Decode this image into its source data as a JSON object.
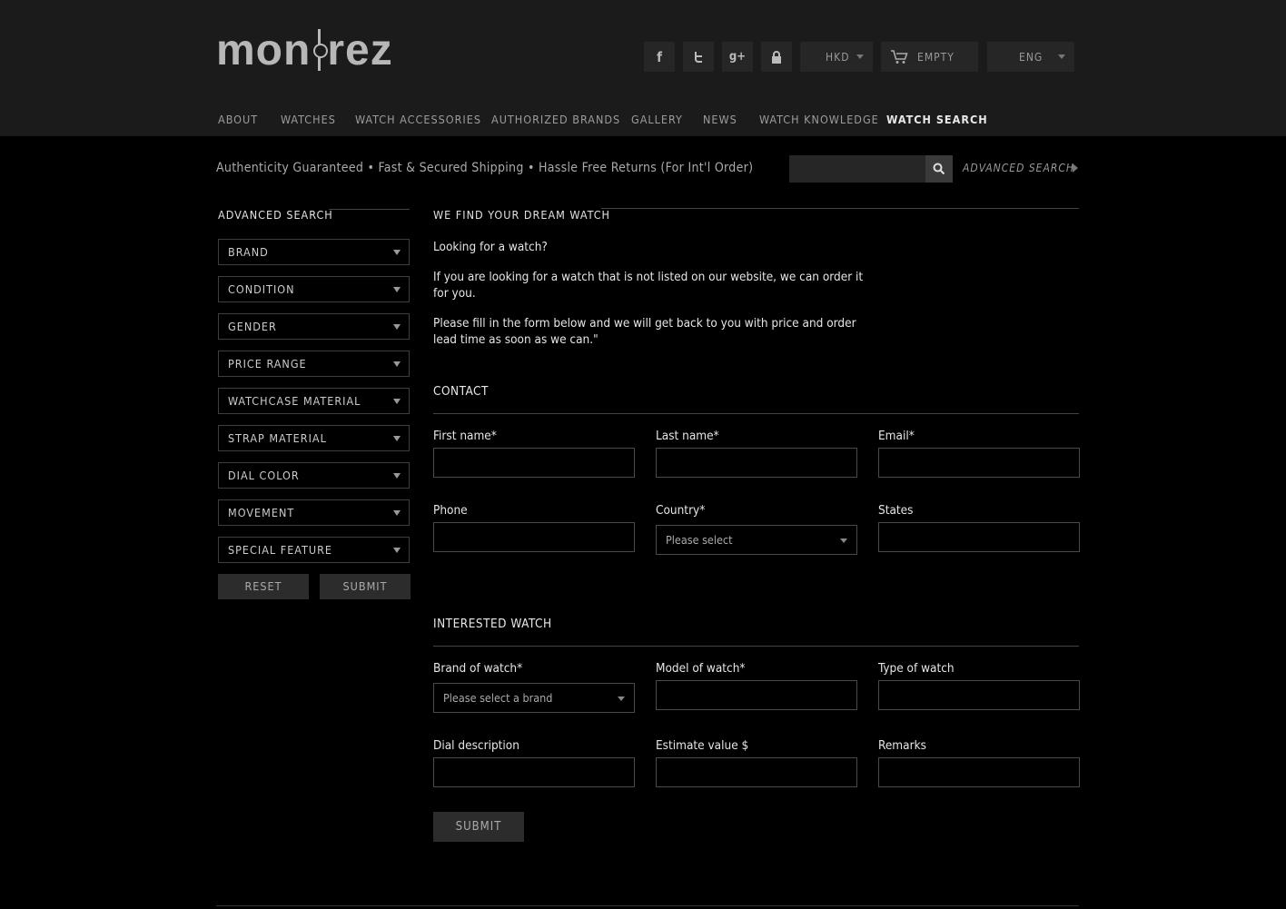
{
  "header": {
    "logo_text": {
      "a": "mon",
      "b": "rez"
    },
    "social": {
      "facebook": "f",
      "twitter": "t",
      "googleplus": "g+"
    },
    "currency": "HKD",
    "cart": "EMPTY",
    "language": "ENG"
  },
  "nav": {
    "items": [
      "ABOUT",
      "WATCHES",
      "WATCH ACCESSORIES",
      "AUTHORIZED BRANDS",
      "GALLERY",
      "NEWS",
      "WATCH KNOWLEDGE",
      "WATCH SEARCH"
    ],
    "active": "WATCH SEARCH"
  },
  "promo": {
    "text": "Authenticity Guaranteed • Fast & Secured Shipping • Hassle Free Returns (For Int'l Order)",
    "search_placeholder": "",
    "advanced_link": "ADVANCED SEARCH"
  },
  "sidebar": {
    "title": "ADVANCED SEARCH",
    "filters": [
      "BRAND",
      "CONDITION",
      "GENDER",
      "PRICE RANGE",
      "WATCHCASE MATERIAL",
      "STRAP MATERIAL",
      "DIAL COLOR",
      "MOVEMENT",
      "SPECIAL FEATURE"
    ],
    "reset_label": "RESET",
    "submit_label": "SUBMIT"
  },
  "main": {
    "title": "WE FIND YOUR DREAM WATCH",
    "para1": "Looking for a watch?",
    "para2": "If you are looking for a watch that is not listed on our website, we can order it for you.",
    "para3": "Please fill in the form below and we will get back to you with price and order lead time as soon as we can.\"",
    "contact": {
      "title": "CONTACT",
      "first_name": "First name*",
      "last_name": "Last name*",
      "email": "Email*",
      "phone": "Phone",
      "country": "Country*",
      "country_placeholder": "Please select",
      "states": "States"
    },
    "interested": {
      "title": "INTERESTED WATCH",
      "brand": "Brand of watch*",
      "brand_placeholder": "Please select a brand",
      "model": "Model of watch*",
      "type": "Type of watch",
      "dial": "Dial description",
      "estimate": "Estimate value $",
      "remarks": "Remarks"
    },
    "submit_label": "SUBMIT"
  }
}
